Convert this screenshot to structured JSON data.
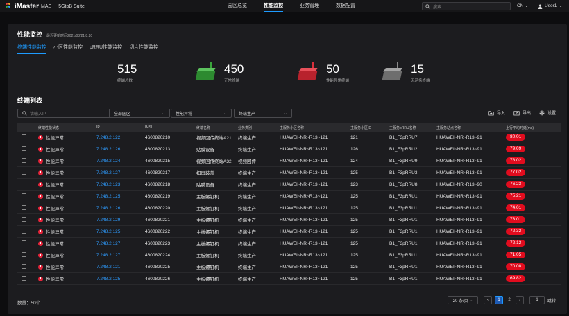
{
  "header": {
    "logo_text": "iMaster",
    "logo_sub": "MAE",
    "suite": "5GtoB Suite",
    "nav": [
      "园区总览",
      "性能监控",
      "业务管理",
      "数据配置"
    ],
    "search_placeholder": "搜索...",
    "lang": "CN",
    "user": "User1"
  },
  "page": {
    "title": "性能监控",
    "updated": "最近更新时间2021/03/21  8:20",
    "tabs": [
      "终端性能监控",
      "小区性能监控",
      "pRRU性能监控",
      "切片性能监控"
    ]
  },
  "stats": [
    {
      "value": "515",
      "label": "终端总数",
      "color": "none"
    },
    {
      "value": "450",
      "label": "正常终端",
      "color": "#3aa63c"
    },
    {
      "value": "50",
      "label": "性能异常终端",
      "color": "#d9303c"
    },
    {
      "value": "15",
      "label": "无话务终端",
      "color": "#8a8a8a"
    }
  ],
  "section_title": "终端列表",
  "filters": {
    "search_placeholder": "请输入IP",
    "campus": "全部园区",
    "status": "性能异常",
    "service": "终端生产"
  },
  "actions": {
    "import": "导入",
    "export": "导出",
    "settings": "设置"
  },
  "table": {
    "headers": [
      "终端性能状态",
      "IP",
      "IMSI",
      "终端名称",
      "业务类别",
      "主服务小区名称",
      "主服务小区ID",
      "主服务pRRU名称",
      "主服务站点名称",
      "上行平均时延(ms)"
    ],
    "rows": [
      [
        "性能异常",
        "7.248.2.122",
        "4600820210",
        "视频回传终端A21",
        "终端生产",
        "HUAWEI~NR~R13~121",
        "121",
        "B1_F3pRRU7",
        "HUAWEI~NR~R13~91",
        "80.01"
      ],
      [
        "性能异常",
        "7.248.2.126",
        "4600820213",
        "贴膜设备",
        "终端生产",
        "HUAWEI~NR~R13~121",
        "126",
        "B1_F3pRRU2",
        "HUAWEI~NR~R13~91",
        "79.09"
      ],
      [
        "性能异常",
        "7.248.2.124",
        "4600820215",
        "视频回传终端A32",
        "视频回传",
        "HUAWEI~NR~R13~121",
        "124",
        "B1_F3pRRU9",
        "HUAWEI~NR~R13~91",
        "78.02"
      ],
      [
        "性能异常",
        "7.248.2.127",
        "4600820217",
        "扣屏装盖",
        "终端生产",
        "HUAWEI~NR~R13~121",
        "125",
        "B1_F3pRRU3",
        "HUAWEI~NR~R13~91",
        "77.02"
      ],
      [
        "性能异常",
        "7.248.2.123",
        "4600820218",
        "贴膜设备",
        "终端生产",
        "HUAWEI~NR~R13~121",
        "123",
        "B1_F3pRRU8",
        "HUAWEI~NR~R13~90",
        "76.23"
      ],
      [
        "性能异常",
        "7.248.2.125",
        "4600820219",
        "主板螺钉机",
        "终端生产",
        "HUAWEI~NR~R13~121",
        "125",
        "B1_F3pRRU1",
        "HUAWEI~NR~R13~91",
        "75.21"
      ],
      [
        "性能异常",
        "7.248.2.126",
        "4600820220",
        "主板螺钉机",
        "终端生产",
        "HUAWEI~NR~R13~121",
        "125",
        "B1_F3pRRU1",
        "HUAWEI~NR~R13~91",
        "74.01"
      ],
      [
        "性能异常",
        "7.248.2.129",
        "4600820221",
        "主板螺钉机",
        "终端生产",
        "HUAWEI~NR~R13~121",
        "125",
        "B1_F3pRRU1",
        "HUAWEI~NR~R13~91",
        "73.01"
      ],
      [
        "性能异常",
        "7.248.2.125",
        "4600820222",
        "主板螺钉机",
        "终端生产",
        "HUAWEI~NR~R13~121",
        "125",
        "B1_F3pRRU1",
        "HUAWEI~NR~R13~91",
        "72.32"
      ],
      [
        "性能异常",
        "7.248.2.127",
        "4600820223",
        "主板螺钉机",
        "终端生产",
        "HUAWEI~NR~R13~121",
        "125",
        "B1_F3pRRU1",
        "HUAWEI~NR~R13~91",
        "72.12"
      ],
      [
        "性能异常",
        "7.248.2.127",
        "4600820224",
        "主板螺钉机",
        "终端生产",
        "HUAWEI~NR~R13~121",
        "125",
        "B1_F3pRRU1",
        "HUAWEI~NR~R13~91",
        "71.05"
      ],
      [
        "性能异常",
        "7.248.2.121",
        "4600820225",
        "主板螺钉机",
        "终端生产",
        "HUAWEI~NR~R13~121",
        "125",
        "B1_F3pRRU1",
        "HUAWEI~NR~R13~91",
        "70.08"
      ],
      [
        "性能异常",
        "7.248.2.125",
        "4600820226",
        "主板螺钉机",
        "终端生产",
        "HUAWEI~NR~R13~121",
        "125",
        "B1_F3pRRU1",
        "HUAWEI~NR~R13~91",
        "69.82"
      ]
    ]
  },
  "footer": {
    "count": "数量：50个",
    "page_size": "20 条/页",
    "pages": [
      "1",
      "2"
    ],
    "goto_value": "1",
    "goto_label": "跳转"
  }
}
